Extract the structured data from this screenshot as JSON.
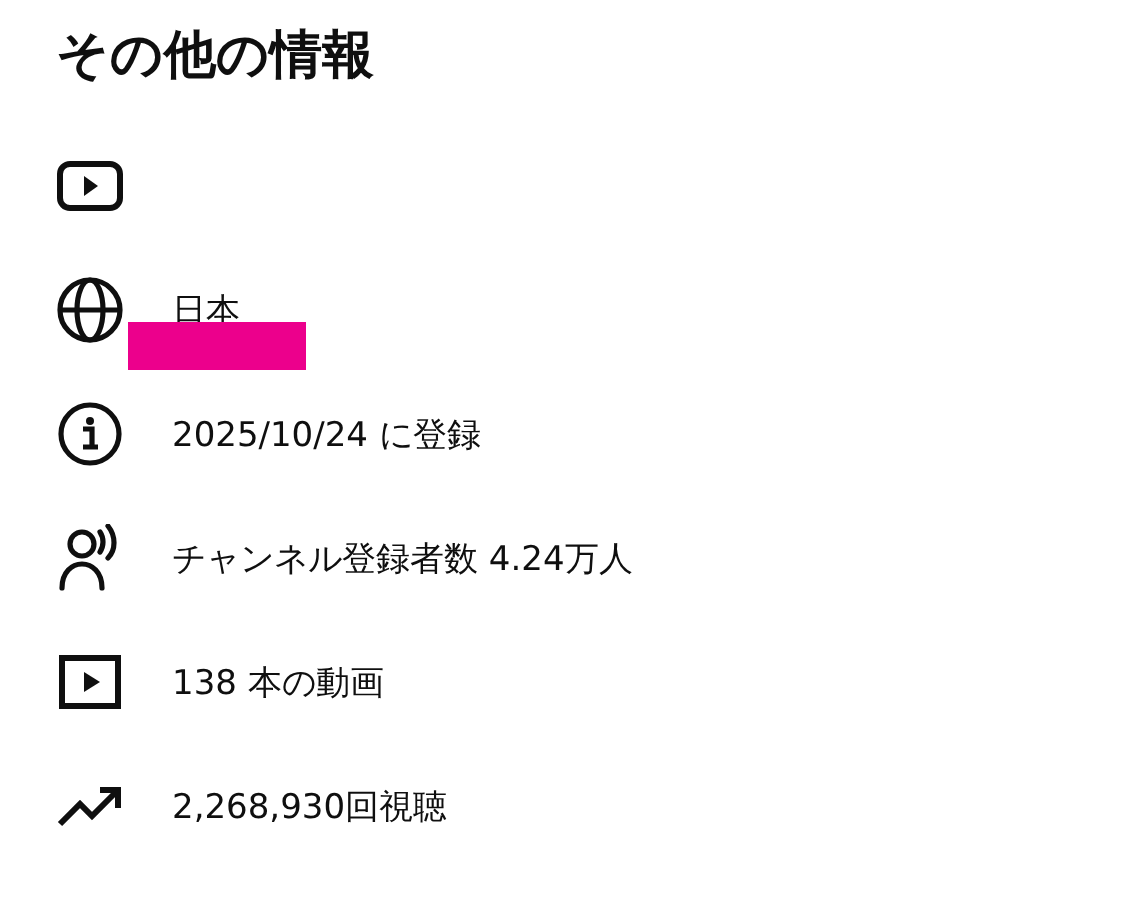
{
  "title": "その他の情報",
  "items": [
    {
      "kind": "channel-link",
      "redacted": false
    },
    {
      "kind": "country",
      "text": "日本",
      "redacted": true
    },
    {
      "kind": "joined",
      "text": "2025/10/24 に登録",
      "redacted": false
    },
    {
      "kind": "subscribers",
      "text": "チャンネル登録者数 4.24万人",
      "redacted": false
    },
    {
      "kind": "videos",
      "text": "138 本の動画",
      "redacted": false
    },
    {
      "kind": "views",
      "text": "2,268,930回視聴",
      "redacted": false
    }
  ]
}
